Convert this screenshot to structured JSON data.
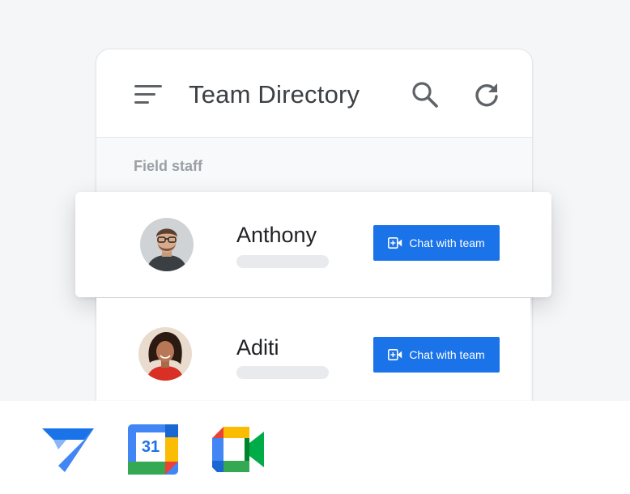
{
  "header": {
    "title": "Team Directory",
    "menu_icon": "menu-icon",
    "search_icon": "search-icon",
    "refresh_icon": "refresh-icon"
  },
  "section": {
    "label": "Field staff"
  },
  "people": [
    {
      "name": "Anthony",
      "button_label": "Chat with team",
      "avatar": "avatar-photo",
      "button_icon": "video-chat-icon"
    },
    {
      "name": "Aditi",
      "button_label": "Chat with team",
      "avatar": "avatar-photo",
      "button_icon": "video-chat-icon"
    }
  ],
  "footer_logos": [
    "appsheet-logo",
    "google-calendar-logo",
    "google-meet-logo"
  ],
  "calendar_day": "31",
  "colors": {
    "accent": "#1a73e8",
    "google_blue": "#4285f4",
    "google_red": "#ea4335",
    "google_yellow": "#fbbc04",
    "google_green": "#34a853"
  }
}
